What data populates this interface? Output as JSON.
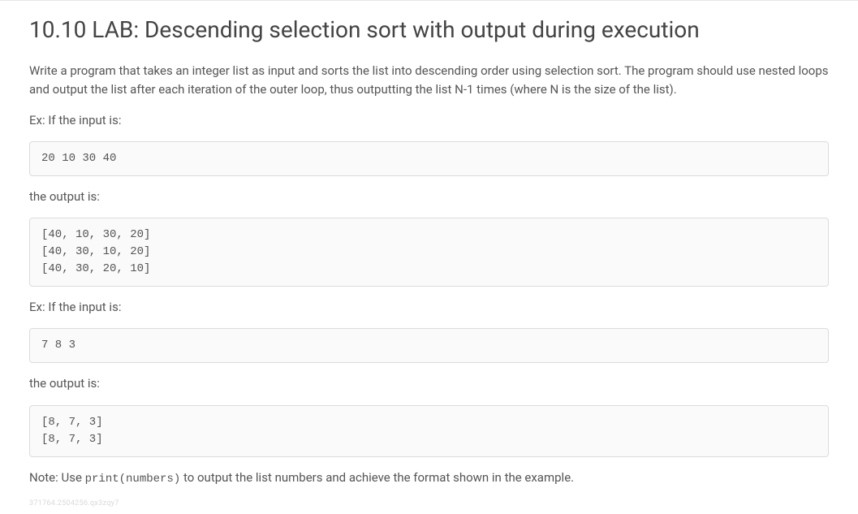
{
  "title": "10.10 LAB: Descending selection sort with output during execution",
  "intro": "Write a program that takes an integer list as input and sorts the list into descending order using selection sort. The program should use nested loops and output the list after each iteration of the outer loop, thus outputting the list N-1 times (where N is the size of the list).",
  "ex1_label": "Ex: If the input is:",
  "ex1_input": "20 10 30 40",
  "output_label": "the output is:",
  "ex1_output": "[40, 10, 30, 20]\n[40, 30, 10, 20]\n[40, 30, 20, 10]",
  "ex2_label": "Ex: If the input is:",
  "ex2_input": "7 8 3",
  "ex2_output": "[8, 7, 3]\n[8, 7, 3]",
  "note_prefix": "Note: Use ",
  "note_code": "print(numbers)",
  "note_suffix": " to output the list numbers and achieve the format shown in the example.",
  "watermark": "371764.2504256.qx3zqy7"
}
